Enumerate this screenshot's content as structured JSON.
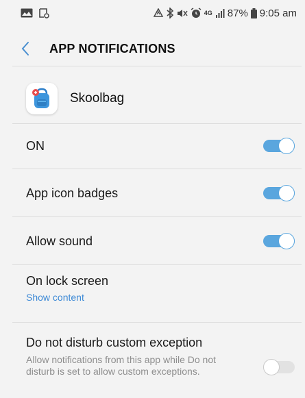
{
  "status_bar": {
    "time": "9:05 am",
    "battery": "87%",
    "network": "4G",
    "icons": [
      "gallery-icon",
      "screen-recorder-icon",
      "recycle-icon",
      "bluetooth-icon",
      "mute-icon",
      "alarm-icon",
      "signal-icon",
      "battery-icon"
    ]
  },
  "header": {
    "title": "APP NOTIFICATIONS",
    "back_icon": "chevron-left-icon"
  },
  "app": {
    "name": "Skoolbag",
    "icon": "backpack-icon"
  },
  "settings": {
    "on": {
      "label": "ON",
      "enabled": true
    },
    "app_icon_badges": {
      "label": "App icon badges",
      "enabled": true
    },
    "allow_sound": {
      "label": "Allow sound",
      "enabled": true
    },
    "lock_screen": {
      "label": "On lock screen",
      "value": "Show content"
    },
    "dnd_exception": {
      "label": "Do not disturb custom exception",
      "description": "Allow notifications from this app while Do not disturb is set to allow custom exceptions.",
      "enabled": false
    }
  },
  "colors": {
    "accent": "#5aa6de",
    "link": "#3e8ad6",
    "background": "#f3f3f3",
    "divider": "#dcdcdc"
  }
}
